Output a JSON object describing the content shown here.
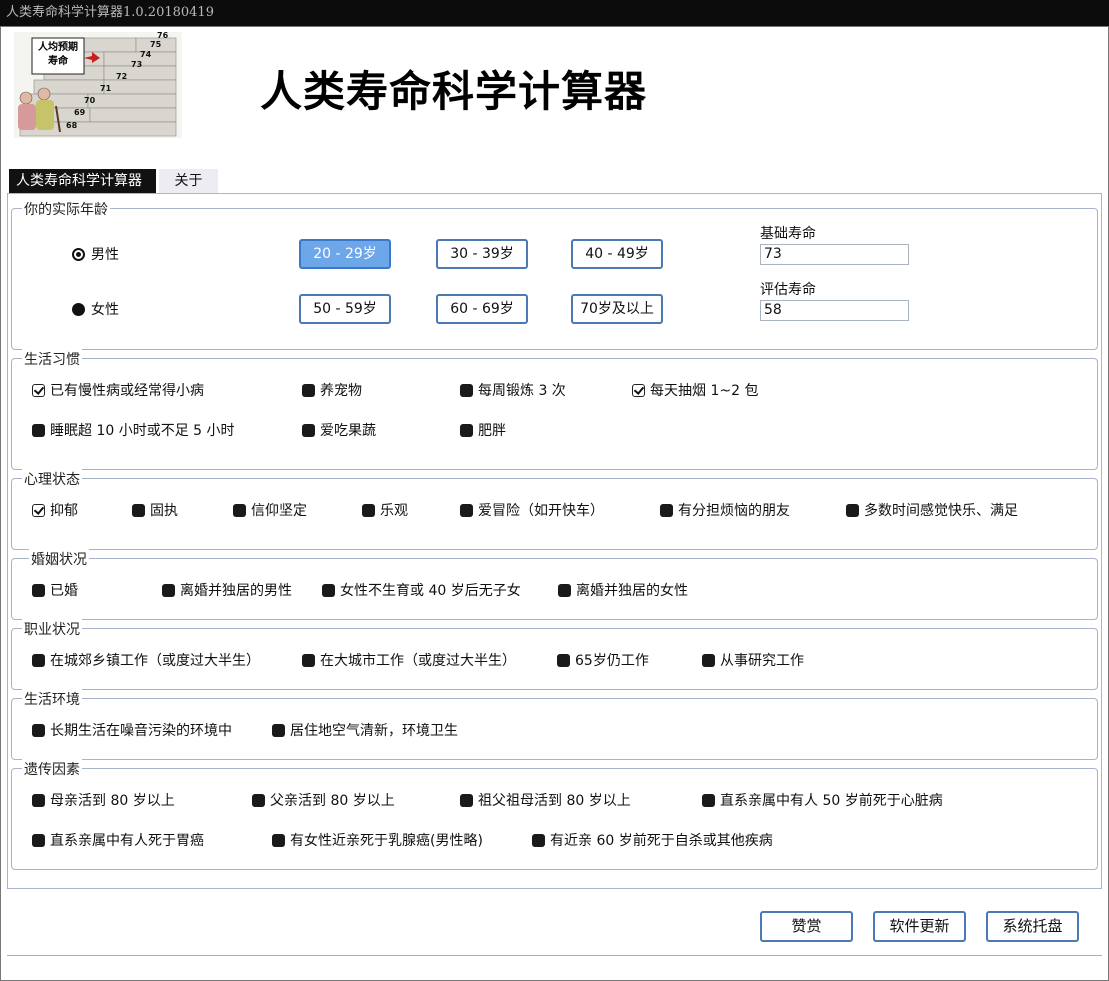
{
  "window": {
    "title": "人类寿命科学计算器1.0.20180419"
  },
  "logo": {
    "sign": "人均预期寿命",
    "steps": [
      "76",
      "75",
      "74",
      "73",
      "72",
      "71",
      "70",
      "69",
      "68"
    ]
  },
  "app_title": "人类寿命科学计算器",
  "tabs": [
    {
      "label": "人类寿命科学计算器",
      "active": true
    },
    {
      "label": "关于",
      "active": false
    }
  ],
  "age_group": {
    "legend": "你的实际年龄",
    "gender": [
      {
        "label": "男性",
        "checked": true
      },
      {
        "label": "女性",
        "checked": false
      }
    ],
    "age_buttons": [
      {
        "label": "20 - 29岁",
        "selected": true
      },
      {
        "label": "30 - 39岁",
        "selected": false
      },
      {
        "label": "40 - 49岁",
        "selected": false
      },
      {
        "label": "50 - 59岁",
        "selected": false
      },
      {
        "label": "60 - 69岁",
        "selected": false
      },
      {
        "label": "70岁及以上",
        "selected": false
      }
    ],
    "base_life_label": "基础寿命",
    "base_life_value": "73",
    "est_life_label": "评估寿命",
    "est_life_value": "58"
  },
  "habits": {
    "legend": "生活习惯",
    "options": [
      {
        "label": "已有慢性病或经常得小病",
        "checked": true
      },
      {
        "label": "养宠物",
        "checked": false
      },
      {
        "label": "每周锻炼 3 次",
        "checked": false
      },
      {
        "label": "每天抽烟 1~2 包",
        "checked": true
      },
      {
        "label": "睡眠超 10 小时或不足 5 小时",
        "checked": false
      },
      {
        "label": "爱吃果蔬",
        "checked": false
      },
      {
        "label": "肥胖",
        "checked": false
      }
    ]
  },
  "mental": {
    "legend": "心理状态",
    "options": [
      {
        "label": "抑郁",
        "checked": true
      },
      {
        "label": "固执",
        "checked": false
      },
      {
        "label": "信仰坚定",
        "checked": false
      },
      {
        "label": "乐观",
        "checked": false
      },
      {
        "label": "爱冒险（如开快车）",
        "checked": false
      },
      {
        "label": "有分担烦恼的朋友",
        "checked": false
      },
      {
        "label": "多数时间感觉快乐、满足",
        "checked": false
      }
    ]
  },
  "marriage": {
    "legend": "婚姻状况",
    "options": [
      {
        "label": "已婚",
        "checked": false
      },
      {
        "label": "离婚并独居的男性",
        "checked": false
      },
      {
        "label": "女性不生育或 40 岁后无子女",
        "checked": false
      },
      {
        "label": "离婚并独居的女性",
        "checked": false
      }
    ]
  },
  "career": {
    "legend": "职业状况",
    "options": [
      {
        "label": "在城郊乡镇工作（或度过大半生）",
        "checked": false
      },
      {
        "label": "在大城市工作（或度过大半生）",
        "checked": false
      },
      {
        "label": "65岁仍工作",
        "checked": false
      },
      {
        "label": "从事研究工作",
        "checked": false
      }
    ]
  },
  "environment": {
    "legend": "生活环境",
    "options": [
      {
        "label": "长期生活在噪音污染的环境中",
        "checked": false
      },
      {
        "label": "居住地空气清新，环境卫生",
        "checked": false
      }
    ]
  },
  "genetics": {
    "legend": "遗传因素",
    "options": [
      {
        "label": "母亲活到 80 岁以上",
        "checked": false
      },
      {
        "label": "父亲活到 80 岁以上",
        "checked": false
      },
      {
        "label": "祖父祖母活到 80 岁以上",
        "checked": false
      },
      {
        "label": "直系亲属中有人 50 岁前死于心脏病",
        "checked": false
      },
      {
        "label": "直系亲属中有人死于胃癌",
        "checked": false
      },
      {
        "label": "有女性近亲死于乳腺癌(男性略)",
        "checked": false
      },
      {
        "label": "有近亲 60 岁前死于自杀或其他疾病",
        "checked": false
      }
    ]
  },
  "buttons": {
    "praise": "赞赏",
    "update": "软件更新",
    "tray": "系统托盘"
  }
}
